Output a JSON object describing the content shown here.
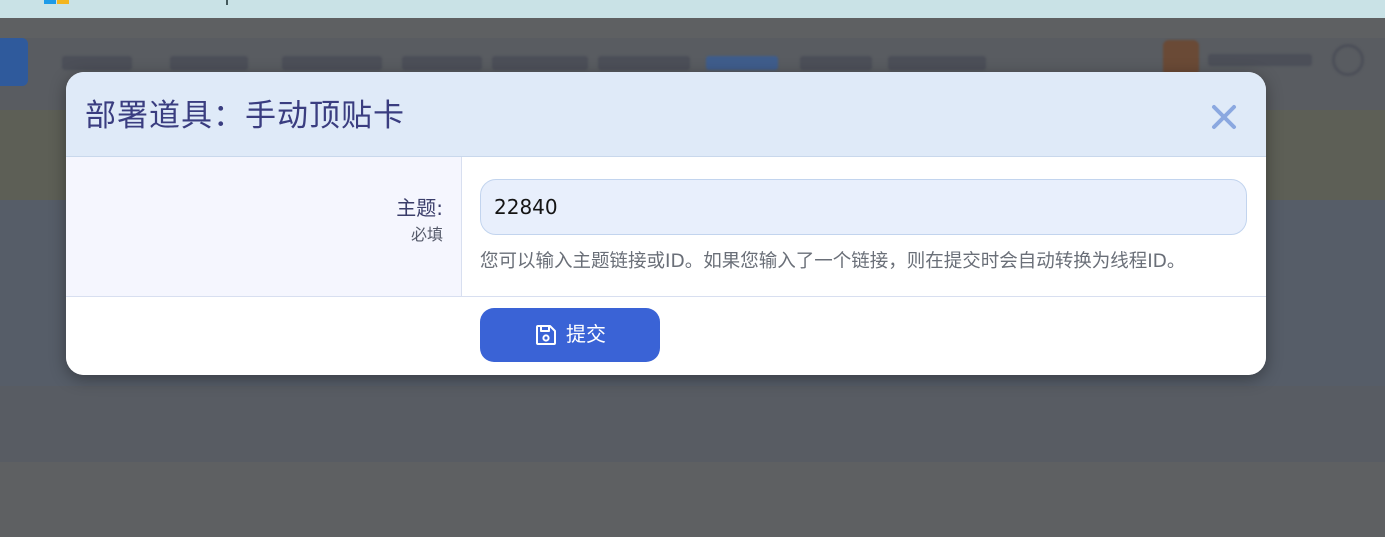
{
  "modal": {
    "title": "部署道具：手动顶贴卡",
    "field": {
      "label": "主题:",
      "required": "必填",
      "value": "22840",
      "hint": "您可以输入主题链接或ID。如果您输入了一个链接，则在提交时会自动转换为线程ID。"
    },
    "submit_label": "提交",
    "icons": {
      "close": "close-icon",
      "submit": "save-icon"
    }
  },
  "colors": {
    "accent": "#3a63d6",
    "header_bg": "#dfeaf8",
    "title": "#3a3d80",
    "close": "#8ba8e0"
  }
}
